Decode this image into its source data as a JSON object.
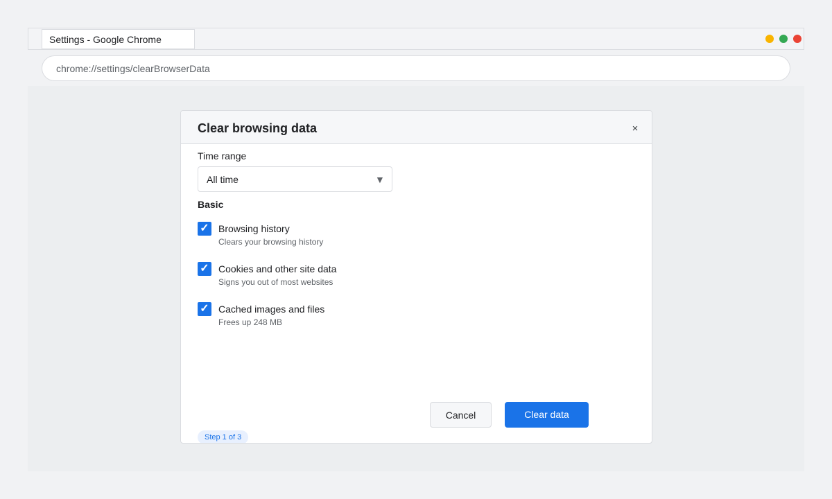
{
  "window": {
    "tab_title": "Settings - Google Chrome",
    "controls": {
      "min_color": "#f9b400",
      "max_color": "#34a853",
      "close_color": "#ea4335"
    }
  },
  "omnibox": {
    "url": "chrome://settings/clearBrowserData"
  },
  "dialog": {
    "title": "Clear browsing data",
    "close_icon": "×",
    "time_range": {
      "label": "Time range",
      "selected": "All time",
      "caret": "▼"
    },
    "section_label": "Basic",
    "options": [
      {
        "label": "Browsing history",
        "description": "Clears your browsing history",
        "checked": true
      },
      {
        "label": "Cookies and other site data",
        "description": "Signs you out of most websites",
        "checked": true
      },
      {
        "label": "Cached images and files",
        "description": "Frees up 248 MB",
        "checked": true
      }
    ],
    "check_glyph": "✓",
    "cancel_label": "Cancel",
    "confirm_label": "Clear data",
    "step_badge": "Step 1 of 3"
  },
  "colors": {
    "accent": "#1a73e8"
  }
}
